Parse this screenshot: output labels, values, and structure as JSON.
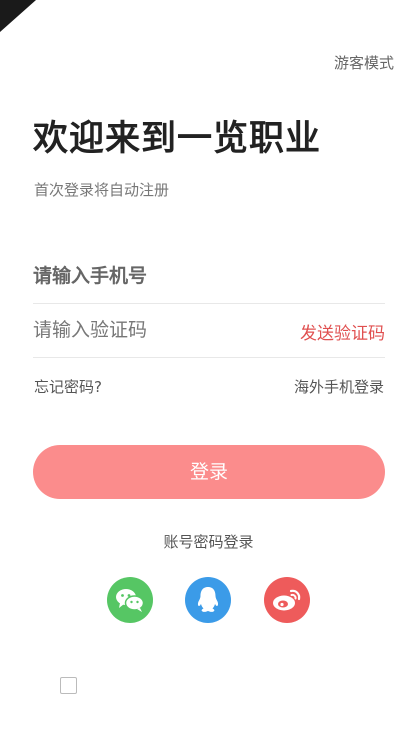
{
  "header": {
    "guest_mode": "游客模式"
  },
  "welcome": {
    "title": "欢迎来到一览职业",
    "subtitle": "首次登录将自动注册"
  },
  "form": {
    "phone_placeholder": "请输入手机号",
    "code_placeholder": "请输入验证码",
    "send_code": "发送验证码",
    "forgot_password": "忘记密码?",
    "overseas_login": "海外手机登录",
    "login_button": "登录"
  },
  "alt_login": {
    "password_login": "账号密码登录"
  },
  "social_icons": [
    "wechat-icon",
    "qq-icon",
    "weibo-icon"
  ],
  "colors": {
    "accent": "#e05050",
    "login_button": "#fb8c8c",
    "wechat": "#56c664",
    "qq": "#3b9be8",
    "weibo": "#ee5b5b"
  }
}
